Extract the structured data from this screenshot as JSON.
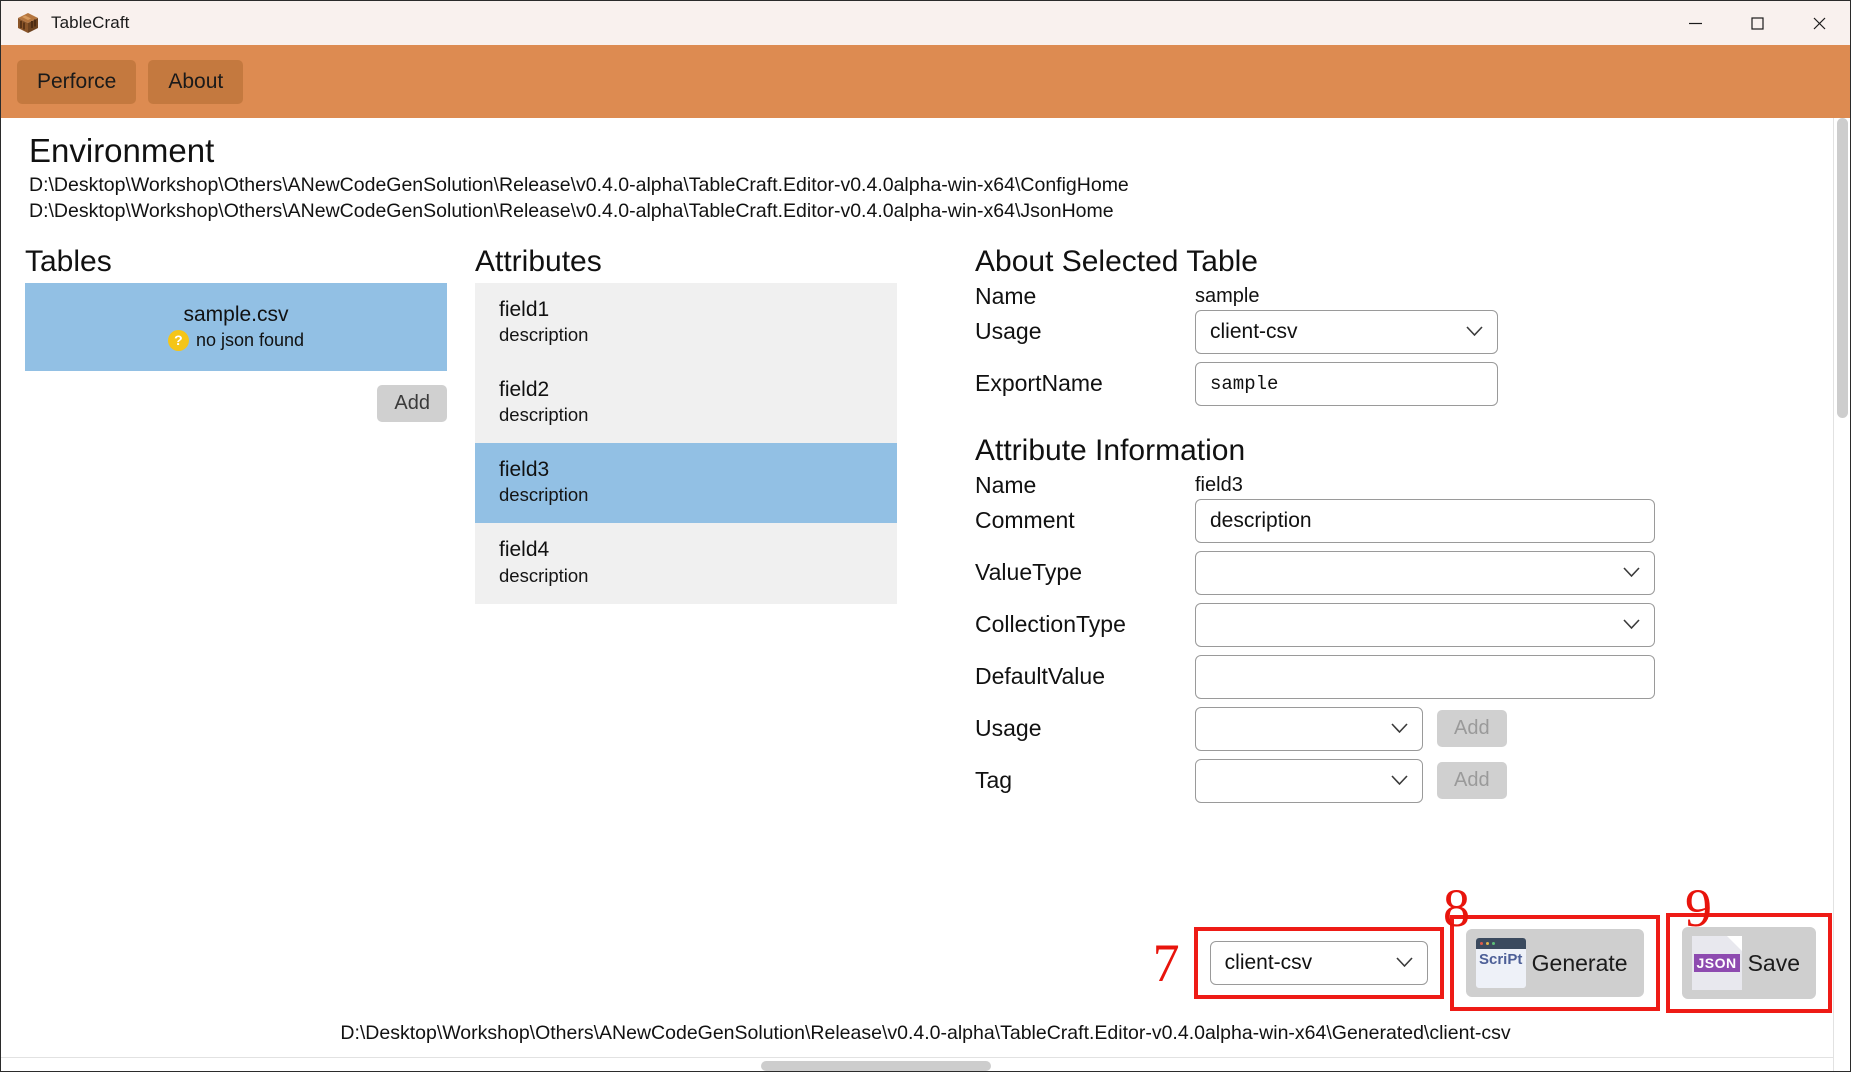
{
  "window": {
    "title": "TableCraft",
    "app_icon": "crate-box-icon",
    "minimize_label": "—",
    "maximize_label": "□",
    "close_label": "✕"
  },
  "menubar": {
    "items": [
      {
        "label": "Perforce",
        "name": "menu-perforce"
      },
      {
        "label": "About",
        "name": "menu-about"
      }
    ],
    "background": "#dd8b51",
    "button_background": "#c4793f"
  },
  "environment": {
    "heading": "Environment",
    "config_home_path": "D:\\Desktop\\Workshop\\Others\\ANewCodeGenSolution\\Release\\v0.4.0-alpha\\TableCraft.Editor-v0.4.0alpha-win-x64\\ConfigHome",
    "json_home_path": "D:\\Desktop\\Workshop\\Others\\ANewCodeGenSolution\\Release\\v0.4.0-alpha\\TableCraft.Editor-v0.4.0alpha-win-x64\\JsonHome"
  },
  "tables": {
    "title": "Tables",
    "selected_index": 0,
    "items": [
      {
        "name": "sample.csv",
        "status": "no json found",
        "status_icon": "question-badge-icon",
        "selected": true
      }
    ],
    "add_label": "Add"
  },
  "attributes": {
    "title": "Attributes",
    "selected_index": 2,
    "items": [
      {
        "name": "field1",
        "description": "description",
        "selected": false
      },
      {
        "name": "field2",
        "description": "description",
        "selected": false
      },
      {
        "name": "field3",
        "description": "description",
        "selected": true
      },
      {
        "name": "field4",
        "description": "description",
        "selected": false
      }
    ]
  },
  "about_selected_table": {
    "title": "About Selected Table",
    "name_label": "Name",
    "name_value": "sample",
    "usage_label": "Usage",
    "usage_value": "client-csv",
    "export_name_label": "ExportName",
    "export_name_value": "sample"
  },
  "attribute_information": {
    "title": "Attribute Information",
    "name_label": "Name",
    "name_value": "field3",
    "comment_label": "Comment",
    "comment_value": "description",
    "value_type_label": "ValueType",
    "value_type_value": "",
    "collection_type_label": "CollectionType",
    "collection_type_value": "",
    "default_value_label": "DefaultValue",
    "default_value_value": "",
    "usage_label": "Usage",
    "usage_value": "",
    "usage_add_label": "Add",
    "tag_label": "Tag",
    "tag_value": "",
    "tag_add_label": "Add"
  },
  "bottom_bar": {
    "callout_7": "7",
    "callout_8": "8",
    "callout_9": "9",
    "export_usage_value": "client-csv",
    "generate_label": "Generate",
    "generate_icon": "script-icon",
    "save_label": "Save",
    "save_icon": "json-file-icon",
    "highlight_color": "#ee1b16"
  },
  "status_bar": {
    "output_path": "D:\\Desktop\\Workshop\\Others\\ANewCodeGenSolution\\Release\\v0.4.0-alpha\\TableCraft.Editor-v0.4.0alpha-win-x64\\Generated\\client-csv"
  },
  "icons": {
    "chevron_down": "⌄",
    "script_text": "ScriPt",
    "json_text": "JSON",
    "question_mark": "?"
  }
}
